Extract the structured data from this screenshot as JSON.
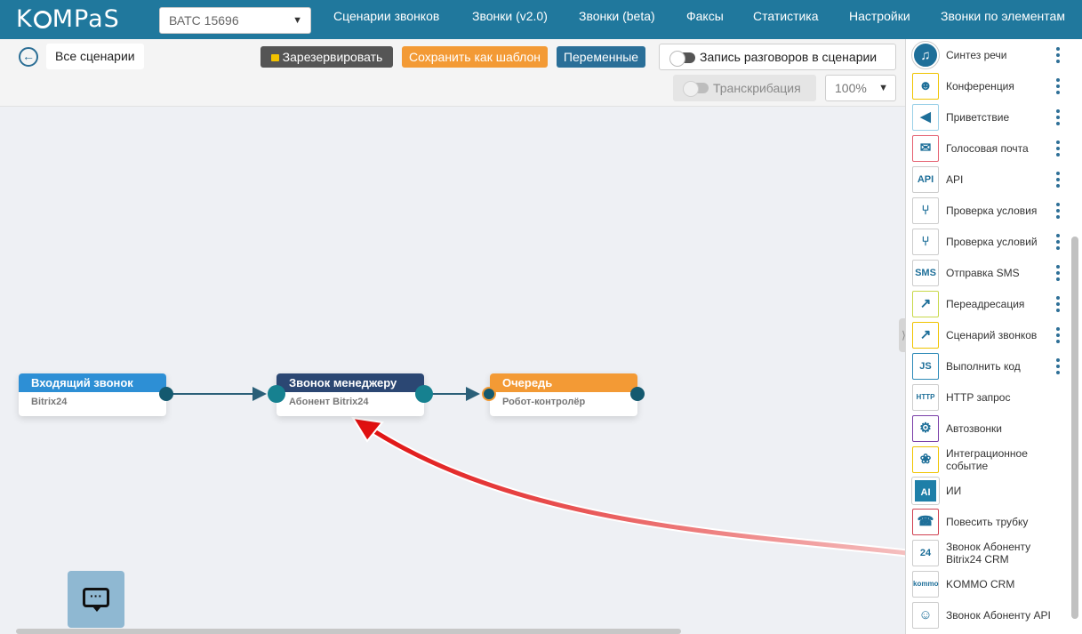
{
  "header": {
    "logo": "KOMPaS",
    "ats_select": "ВАТС 15696",
    "nav": [
      "Сценарии звонков",
      "Звонки (v2.0)",
      "Звонки (beta)",
      "Факсы",
      "Статистика",
      "Настройки",
      "Звонки по элементам"
    ]
  },
  "toolbar": {
    "all_scenarios": "Все сценарии",
    "reserve": "Зарезервировать",
    "save_template": "Сохранить как шаблон",
    "variables": "Переменные",
    "record_calls": "Запись разговоров в сценарии",
    "transcription": "Транскрибация",
    "zoom": "100%"
  },
  "nodes": [
    {
      "title": "Входящий звонок",
      "subtitle": "Bitrix24",
      "color": "#2d8fd5"
    },
    {
      "title": "Звонок менеджеру",
      "subtitle": "Абонент Bitrix24",
      "color": "#2b4773"
    },
    {
      "title": "Очередь",
      "subtitle": "Робот-контролёр",
      "color": "#f39a35"
    }
  ],
  "palette": [
    {
      "label": "Синтез речи",
      "icon": "speech-synthesis-icon",
      "has_menu": true
    },
    {
      "label": "Конференция",
      "icon": "conference-icon",
      "has_menu": true
    },
    {
      "label": "Приветствие",
      "icon": "megaphone-icon",
      "has_menu": true
    },
    {
      "label": "Голосовая почта",
      "icon": "voicemail-icon",
      "has_menu": true
    },
    {
      "label": "API",
      "icon": "api-cloud-icon",
      "has_menu": true
    },
    {
      "label": "Проверка условия",
      "icon": "condition-branch-icon",
      "has_menu": true
    },
    {
      "label": "Проверка условий",
      "icon": "conditions-branch-icon",
      "has_menu": true
    },
    {
      "label": "Отправка SMS",
      "icon": "sms-icon",
      "has_menu": true
    },
    {
      "label": "Переадресация",
      "icon": "call-forward-icon",
      "has_menu": true
    },
    {
      "label": "Сценарий звонков",
      "icon": "call-scenario-icon",
      "has_menu": true
    },
    {
      "label": "Выполнить код",
      "icon": "js-icon",
      "has_menu": true
    },
    {
      "label": "HTTP запрос",
      "icon": "http-icon",
      "has_menu": false
    },
    {
      "label": "Автозвонки",
      "icon": "robot-icon",
      "has_menu": false
    },
    {
      "label": "Интеграционное событие",
      "icon": "webhook-icon",
      "has_menu": false
    },
    {
      "label": "ИИ",
      "icon": "ai-chip-icon",
      "has_menu": false
    },
    {
      "label": "Повесить трубку",
      "icon": "hangup-icon",
      "has_menu": false
    },
    {
      "label": "Звонок Абоненту Bitrix24 CRM",
      "icon": "bitrix24-icon",
      "has_menu": false
    },
    {
      "label": "KOMMO CRM",
      "icon": "kommo-icon",
      "has_menu": false
    },
    {
      "label": "Звонок Абоненту API",
      "icon": "user-api-icon",
      "has_menu": false
    }
  ]
}
